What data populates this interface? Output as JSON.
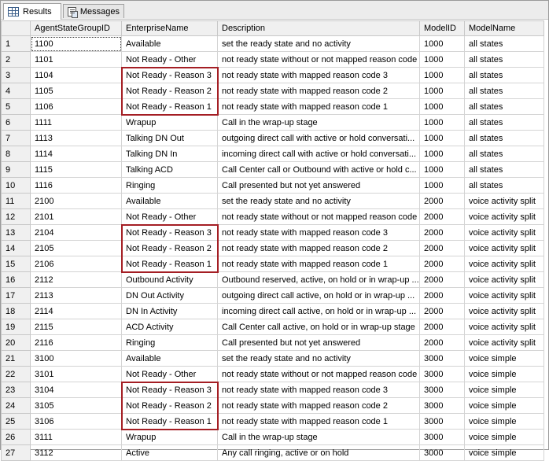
{
  "tabs": [
    {
      "label": "Results",
      "icon": "grid-icon",
      "active": true
    },
    {
      "label": "Messages",
      "icon": "messages-icon",
      "active": false
    }
  ],
  "columns": [
    "",
    "AgentStateGroupID",
    "EnterpriseName",
    "Description",
    "ModelID",
    "ModelName"
  ],
  "rows": [
    [
      "1",
      "1100",
      "Available",
      "set the ready state and no activity",
      "1000",
      "all states"
    ],
    [
      "2",
      "1101",
      "Not Ready - Other",
      "not ready state without or not mapped reason code",
      "1000",
      "all states"
    ],
    [
      "3",
      "1104",
      "Not Ready - Reason 3",
      "not ready state with mapped reason code 3",
      "1000",
      "all states"
    ],
    [
      "4",
      "1105",
      "Not Ready - Reason 2",
      "not ready state with mapped reason code 2",
      "1000",
      "all states"
    ],
    [
      "5",
      "1106",
      "Not Ready - Reason 1",
      "not ready state with mapped reason code 1",
      "1000",
      "all states"
    ],
    [
      "6",
      "1111",
      "Wrapup",
      "Call in the wrap-up stage",
      "1000",
      "all states"
    ],
    [
      "7",
      "1113",
      "Talking DN Out",
      "outgoing direct call with active or hold conversati...",
      "1000",
      "all states"
    ],
    [
      "8",
      "1114",
      "Talking DN In",
      "incoming direct call with active or hold conversati...",
      "1000",
      "all states"
    ],
    [
      "9",
      "1115",
      "Talking ACD",
      "Call Center call or Outbound with active or hold c...",
      "1000",
      "all states"
    ],
    [
      "10",
      "1116",
      "Ringing",
      "Call presented but not yet answered",
      "1000",
      "all states"
    ],
    [
      "11",
      "2100",
      "Available",
      "set the ready state and no activity",
      "2000",
      "voice activity split"
    ],
    [
      "12",
      "2101",
      "Not Ready - Other",
      "not ready state without or not mapped reason code",
      "2000",
      "voice activity split"
    ],
    [
      "13",
      "2104",
      "Not Ready - Reason 3",
      "not ready state with mapped reason code 3",
      "2000",
      "voice activity split"
    ],
    [
      "14",
      "2105",
      "Not Ready - Reason 2",
      "not ready state with mapped reason code 2",
      "2000",
      "voice activity split"
    ],
    [
      "15",
      "2106",
      "Not Ready - Reason 1",
      "not ready state with mapped reason code 1",
      "2000",
      "voice activity split"
    ],
    [
      "16",
      "2112",
      "Outbound Activity",
      "Outbound reserved, active, on hold or in wrap-up ...",
      "2000",
      "voice activity split"
    ],
    [
      "17",
      "2113",
      "DN Out Activity",
      "outgoing direct call active, on hold or in wrap-up ...",
      "2000",
      "voice activity split"
    ],
    [
      "18",
      "2114",
      "DN In Activity",
      "incoming direct call active, on hold or in wrap-up ...",
      "2000",
      "voice activity split"
    ],
    [
      "19",
      "2115",
      "ACD Activity",
      "Call Center call active, on hold or in wrap-up stage",
      "2000",
      "voice activity split"
    ],
    [
      "20",
      "2116",
      "Ringing",
      "Call presented but not yet answered",
      "2000",
      "voice activity split"
    ],
    [
      "21",
      "3100",
      "Available",
      "set the ready state and no activity",
      "3000",
      "voice simple"
    ],
    [
      "22",
      "3101",
      "Not Ready - Other",
      "not ready state without or not mapped reason code",
      "3000",
      "voice simple"
    ],
    [
      "23",
      "3104",
      "Not Ready - Reason 3",
      "not ready state with mapped reason code 3",
      "3000",
      "voice simple"
    ],
    [
      "24",
      "3105",
      "Not Ready - Reason 2",
      "not ready state with mapped reason code 2",
      "3000",
      "voice simple"
    ],
    [
      "25",
      "3106",
      "Not Ready - Reason 1",
      "not ready state with mapped reason code 1",
      "3000",
      "voice simple"
    ],
    [
      "26",
      "3111",
      "Wrapup",
      "Call in the wrap-up stage",
      "3000",
      "voice simple"
    ],
    [
      "27",
      "3112",
      "Active",
      "Any call ringing, active or on hold",
      "3000",
      "voice simple"
    ]
  ],
  "selected_cell": {
    "row": 0,
    "column": 1
  },
  "highlight_groups": [
    [
      2,
      4
    ],
    [
      12,
      14
    ],
    [
      22,
      24
    ]
  ],
  "colors": {
    "highlight_border": "#a41e24",
    "header_bg": "#f0f0f0",
    "gridline": "#d4d4d4"
  }
}
